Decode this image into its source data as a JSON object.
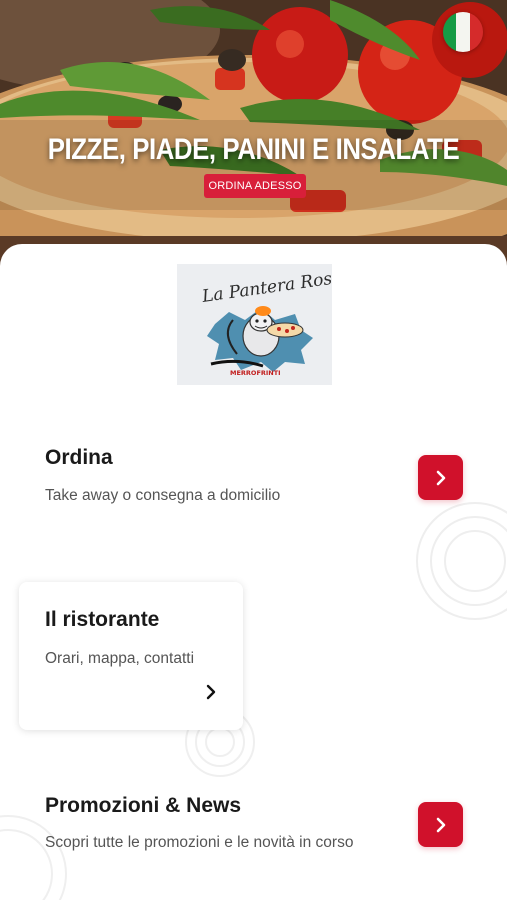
{
  "hero": {
    "title": "PIZZE, PIADE, PANINI E INSALATE",
    "cta_label": "ORDINA ADESSO",
    "language_flag": "italy-flag-icon"
  },
  "logo": {
    "script_text": "La Pantera Rosa",
    "subtext": "MERROFRINTI"
  },
  "sections": {
    "ordina": {
      "title": "Ordina",
      "subtitle": "Take away o consegna a domicilio"
    },
    "ristorante": {
      "title": "Il ristorante",
      "subtitle": "Orari, mappa, contatti"
    },
    "promozioni": {
      "title": "Promozioni & News",
      "subtitle": "Scopri tutte le promozioni e le novità in corso"
    }
  },
  "colors": {
    "accent": "#d0112b",
    "cta": "#d81f3a"
  }
}
